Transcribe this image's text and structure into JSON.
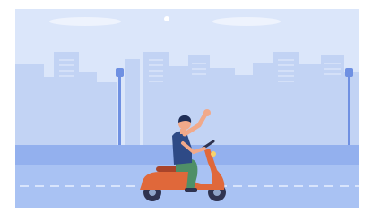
{
  "scene": {
    "subject": "person-riding-scooter-waving",
    "colors": {
      "sky": "#dbe6fa",
      "sky_bottom": "#d3e0f8",
      "skyline": "#c2d3f4",
      "skyline_light": "#d4e0f8",
      "road": "#a9c2f3",
      "curb": "#93b0ee",
      "lane_marking": "#e8efff",
      "lamp": "#6f90e2",
      "scooter": "#e0683a",
      "scooter_dark": "#a9442a",
      "wheel": "#2f3350",
      "shirt": "#2e4a86",
      "pants": "#4f8f67",
      "skin": "#f1a98a",
      "hair": "#1f2e57"
    }
  }
}
